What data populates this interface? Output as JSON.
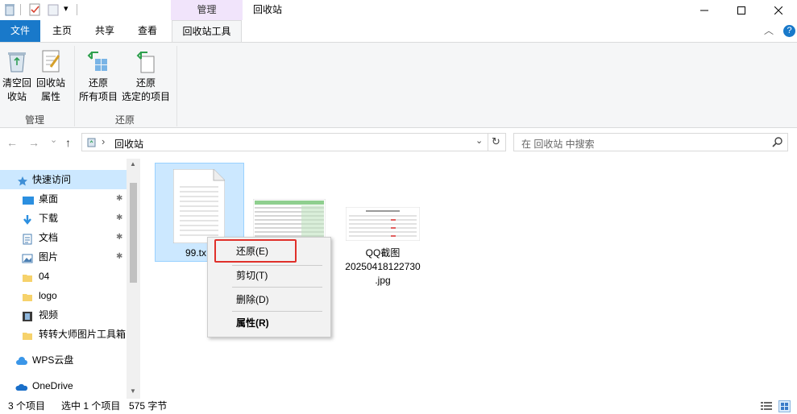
{
  "window": {
    "title": "回收站",
    "context_tab_header": "管理",
    "minimize_glyph": "—",
    "maximize_glyph": "☐",
    "close_glyph": "✕",
    "qat_chevron": "▾"
  },
  "tabs": {
    "file": "文件",
    "home": "主页",
    "share": "共享",
    "view": "查看",
    "recycle_tools": "回收站工具",
    "collapse_glyph": "︿",
    "help_glyph": "?"
  },
  "ribbon": {
    "empty_recycle": [
      "清空回",
      "收站"
    ],
    "recycle_props": [
      "回收站",
      "属性"
    ],
    "restore_all": [
      "还原",
      "所有项目"
    ],
    "restore_selected": [
      "还原",
      "选定的项目"
    ],
    "group_manage": "管理",
    "group_restore": "还原"
  },
  "address": {
    "back": "←",
    "forward": "→",
    "recent": "⌄",
    "up": "↑",
    "breadcrumb_sep": "›",
    "location": "回收站",
    "dropdown": "⌄",
    "search_placeholder": "在 回收站 中搜索"
  },
  "sidebar": {
    "items": [
      {
        "label": "快速访问",
        "icon": "star-icon"
      },
      {
        "label": "桌面",
        "icon": "desktop-icon",
        "pinned": true
      },
      {
        "label": "下载",
        "icon": "download-icon",
        "pinned": true
      },
      {
        "label": "文档",
        "icon": "document-icon",
        "pinned": true
      },
      {
        "label": "图片",
        "icon": "pictures-icon",
        "pinned": true
      },
      {
        "label": "04",
        "icon": "folder-icon"
      },
      {
        "label": "logo",
        "icon": "folder-icon"
      },
      {
        "label": "视频",
        "icon": "video-icon"
      },
      {
        "label": "转转大师图片工具箱",
        "icon": "folder-icon"
      },
      {
        "label": "WPS云盘",
        "icon": "cloud-icon"
      },
      {
        "label": "OneDrive",
        "icon": "onedrive-icon"
      }
    ],
    "pin_glyph": "📌"
  },
  "files": [
    {
      "name": "99.tx",
      "type": "text-file-icon"
    },
    {
      "name": "",
      "type": "spreadsheet-thumb-icon"
    },
    {
      "name_lines": [
        "QQ截图",
        "20250418122730",
        ".jpg"
      ],
      "type": "image-thumb-icon"
    }
  ],
  "context_menu": {
    "restore": "还原(E)",
    "cut": "剪切(T)",
    "delete": "删除(D)",
    "properties": "属性(R)",
    "highlight_color": "#e0302a"
  },
  "status": {
    "item_count": "3 个项目",
    "selected": "选中 1 个项目",
    "size": "575 字节"
  },
  "colors": {
    "file_tab": "#1979ca",
    "context_tab": "#f1e4fb",
    "selection": "#cce8ff",
    "ribbon_bg": "#f5f6f7"
  }
}
